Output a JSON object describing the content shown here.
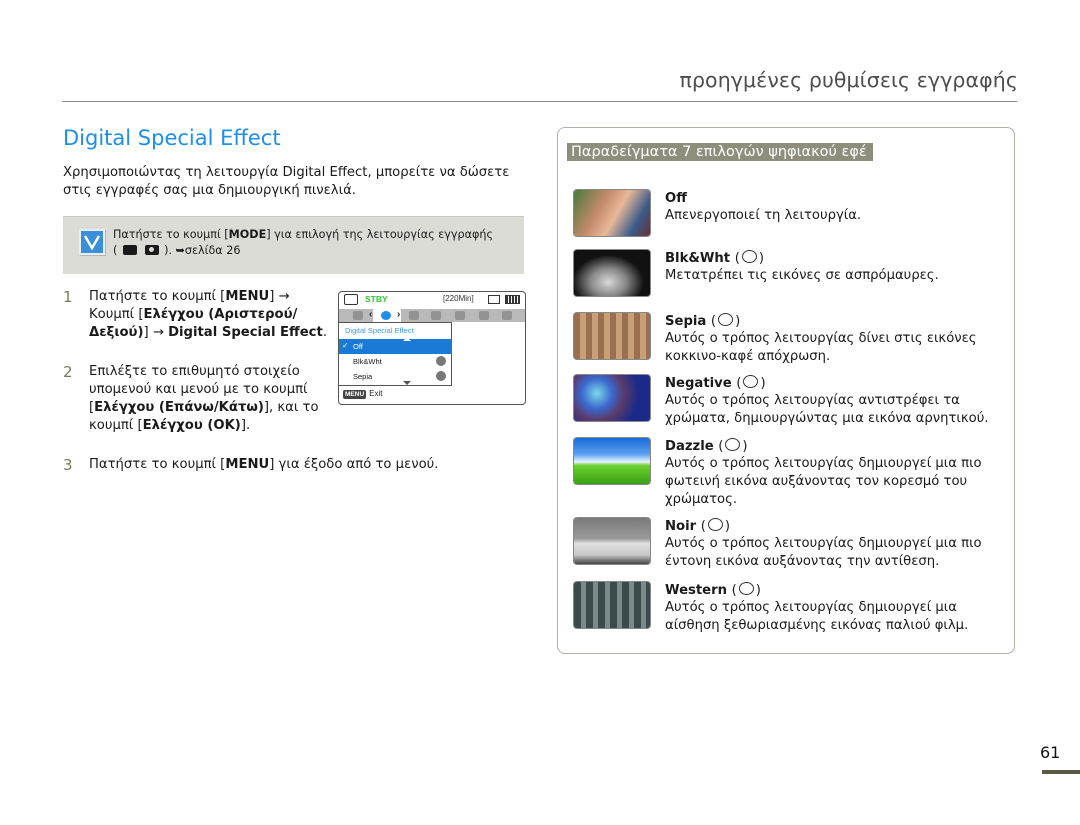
{
  "header": {
    "chapter_title": "προηγμένες ρυθμίσεις εγγραφής"
  },
  "section": {
    "title": "Digital Special Effect",
    "intro": "Χρησιμοποιώντας τη λειτουργία Digital Effect, μπορείτε να δώσετε στις εγγραφές σας μια δημιουργική πινελιά."
  },
  "note": {
    "icon": "checkbox-icon",
    "line1_prefix": "Πατήστε το κουμπί [",
    "line1_bold": "MODE",
    "line1_suffix": "] για επιλογή της λειτουργίας εγγραφής",
    "line2_prefix": "(",
    "line2_suffix": "). ➥σελίδα 26"
  },
  "steps": [
    {
      "number": "1",
      "parts": [
        {
          "t": "Πατήστε το κουμπί [",
          "b": false
        },
        {
          "t": "MENU",
          "b": true
        },
        {
          "t": "] → Κουμπί [",
          "b": false
        },
        {
          "t": "Ελέγχου (Αριστερού/ Δεξιού)",
          "b": true
        },
        {
          "t": "] → ",
          "b": false
        },
        {
          "t": "Digital Special Effect",
          "b": true
        },
        {
          "t": ".",
          "b": false
        }
      ]
    },
    {
      "number": "2",
      "parts": [
        {
          "t": "Επιλέξτε το επιθυμητό στοιχείο υπομενού και μενού με το κουμπί [",
          "b": false
        },
        {
          "t": "Ελέγχου (Επάνω/Κάτω)",
          "b": true
        },
        {
          "t": "], και το κουμπί [",
          "b": false
        },
        {
          "t": "Ελέγχου (OK)",
          "b": true
        },
        {
          "t": "].",
          "b": false
        }
      ]
    },
    {
      "number": "3",
      "parts": [
        {
          "t": "Πατήστε το κουμπί [",
          "b": false
        },
        {
          "t": "MENU",
          "b": true
        },
        {
          "t": "] για έξοδο από το μενού.",
          "b": false
        }
      ]
    }
  ],
  "camera_screen": {
    "status": "STBY",
    "remaining": "[220Min]",
    "menu_title": "Digital Special Effect",
    "items": [
      {
        "label": "Off",
        "selected": true
      },
      {
        "label": "Blk&Wht",
        "selected": false
      },
      {
        "label": "Sepia",
        "selected": false
      }
    ],
    "menu_badge": "MENU",
    "exit_label": "Exit",
    "accent_color": "#1b7ad6",
    "status_color": "#2fcc2f"
  },
  "examples_panel": {
    "title": "Παραδείγματα 7 επιλογών ψηφιακού εφέ",
    "title_bg": "#8f8e7c",
    "items": [
      {
        "name": "Off",
        "has_icon": false,
        "desc": "Απενεργοποιεί τη λειτουργία."
      },
      {
        "name": "Blk&Wht",
        "has_icon": true,
        "desc": "Μετατρέπει τις εικόνες σε ασπρόμαυρες."
      },
      {
        "name": "Sepia",
        "has_icon": true,
        "desc": "Αυτός ο τρόπος λειτουργίας δίνει στις εικόνες κοκκινο-καφέ απόχρωση."
      },
      {
        "name": "Negative",
        "has_icon": true,
        "desc": "Αυτός ο τρόπος λειτουργίας αντιστρέφει τα χρώματα, δημιουργώντας μια εικόνα αρνητικού."
      },
      {
        "name": "Dazzle",
        "has_icon": true,
        "desc": "Αυτός ο τρόπος λειτουργίας δημιουργεί μια πιο φωτεινή εικόνα αυξάνοντας τον κορεσμό του χρώματος."
      },
      {
        "name": "Noir",
        "has_icon": true,
        "desc": "Αυτός ο τρόπος λειτουργίας δημιουργεί μια πιο έντονη εικόνα αυξάνοντας την αντίθεση."
      },
      {
        "name": "Western",
        "has_icon": true,
        "desc": "Αυτός ο τρόπος λειτουργίας δημιουργεί μια αίσθηση ξεθωριασμένης εικόνας παλιού φιλμ."
      }
    ]
  },
  "footer": {
    "page_number": "61"
  },
  "colors": {
    "section_title": "#1e8ee8",
    "note_bg": "#dcdcd7"
  }
}
